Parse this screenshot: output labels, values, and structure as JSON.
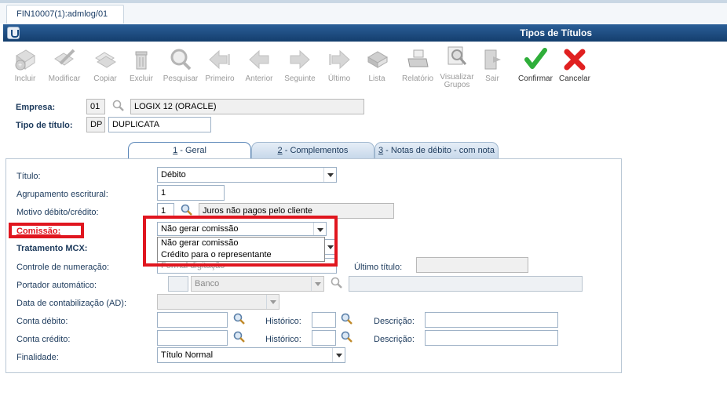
{
  "tab": {
    "label": "FIN10007(1):admlog/01"
  },
  "window": {
    "title": "Tipos de Títulos"
  },
  "toolbar": [
    {
      "label": "Incluir",
      "icon": "add-document-icon",
      "enabled": false
    },
    {
      "label": "Modificar",
      "icon": "edit-pencil-icon",
      "enabled": false
    },
    {
      "label": "Copiar",
      "icon": "copy-icon",
      "enabled": false
    },
    {
      "label": "Excluir",
      "icon": "trash-icon",
      "enabled": false
    },
    {
      "label": "Pesquisar",
      "icon": "search-icon",
      "enabled": false
    },
    {
      "label": "Primeiro",
      "icon": "first-arrow-icon",
      "enabled": false
    },
    {
      "label": "Anterior",
      "icon": "previous-arrow-icon",
      "enabled": false
    },
    {
      "label": "Seguinte",
      "icon": "next-arrow-icon",
      "enabled": false
    },
    {
      "label": "Último",
      "icon": "last-arrow-icon",
      "enabled": false
    },
    {
      "label": "Lista",
      "icon": "list-book-icon",
      "enabled": false
    },
    {
      "label": "Relatório",
      "icon": "printer-icon",
      "enabled": false
    },
    {
      "label": "Visualizar Grupos",
      "icon": "groups-icon",
      "enabled": false
    },
    {
      "label": "Sair",
      "icon": "exit-door-icon",
      "enabled": false
    },
    {
      "label": "Confirmar",
      "icon": "green-check-icon",
      "enabled": true
    },
    {
      "label": "Cancelar",
      "icon": "red-x-icon",
      "enabled": true
    }
  ],
  "header": {
    "empresa_label": "Empresa:",
    "empresa_code": "01",
    "empresa_name": "LOGIX 12 (ORACLE)",
    "tipo_label": "Tipo de título:",
    "tipo_code": "DP",
    "tipo_name": "DUPLICATA"
  },
  "tabs": [
    {
      "num": "1",
      "label": " - Geral"
    },
    {
      "num": "2",
      "label": " - Complementos"
    },
    {
      "num": "3",
      "label": " - Notas de débito - com nota"
    }
  ],
  "form": {
    "titulo_label": "Título:",
    "titulo_value": "Débito",
    "agrupamento_label": "Agrupamento escritural:",
    "agrupamento_value": "1",
    "motivo_label": "Motivo débito/crédito:",
    "motivo_code": "1",
    "motivo_desc": "Juros não pagos pelo cliente",
    "comissao_label": "Comissão:",
    "comissao_value": "Não gerar comissão",
    "comissao_options": [
      "Não gerar comissão",
      "Crédito para o representante"
    ],
    "mcx_label": "Tratamento MCX:",
    "controle_label": "Controle de numeração:",
    "controle_value": "Formal digitação",
    "ultimo_label": "Último título:",
    "portador_label": "Portador automático:",
    "portador_placeholder": "Banco",
    "data_label": "Data de contabilização (AD):",
    "conta_debito_label": "Conta débito:",
    "conta_credito_label": "Conta crédito:",
    "historico_label": "Histórico:",
    "descricao_label": "Descrição:",
    "finalidade_label": "Finalidade:",
    "finalidade_value": "Título Normal"
  },
  "colors": {
    "highlight": "#e0161f",
    "titlebar": "#1f4f85"
  }
}
